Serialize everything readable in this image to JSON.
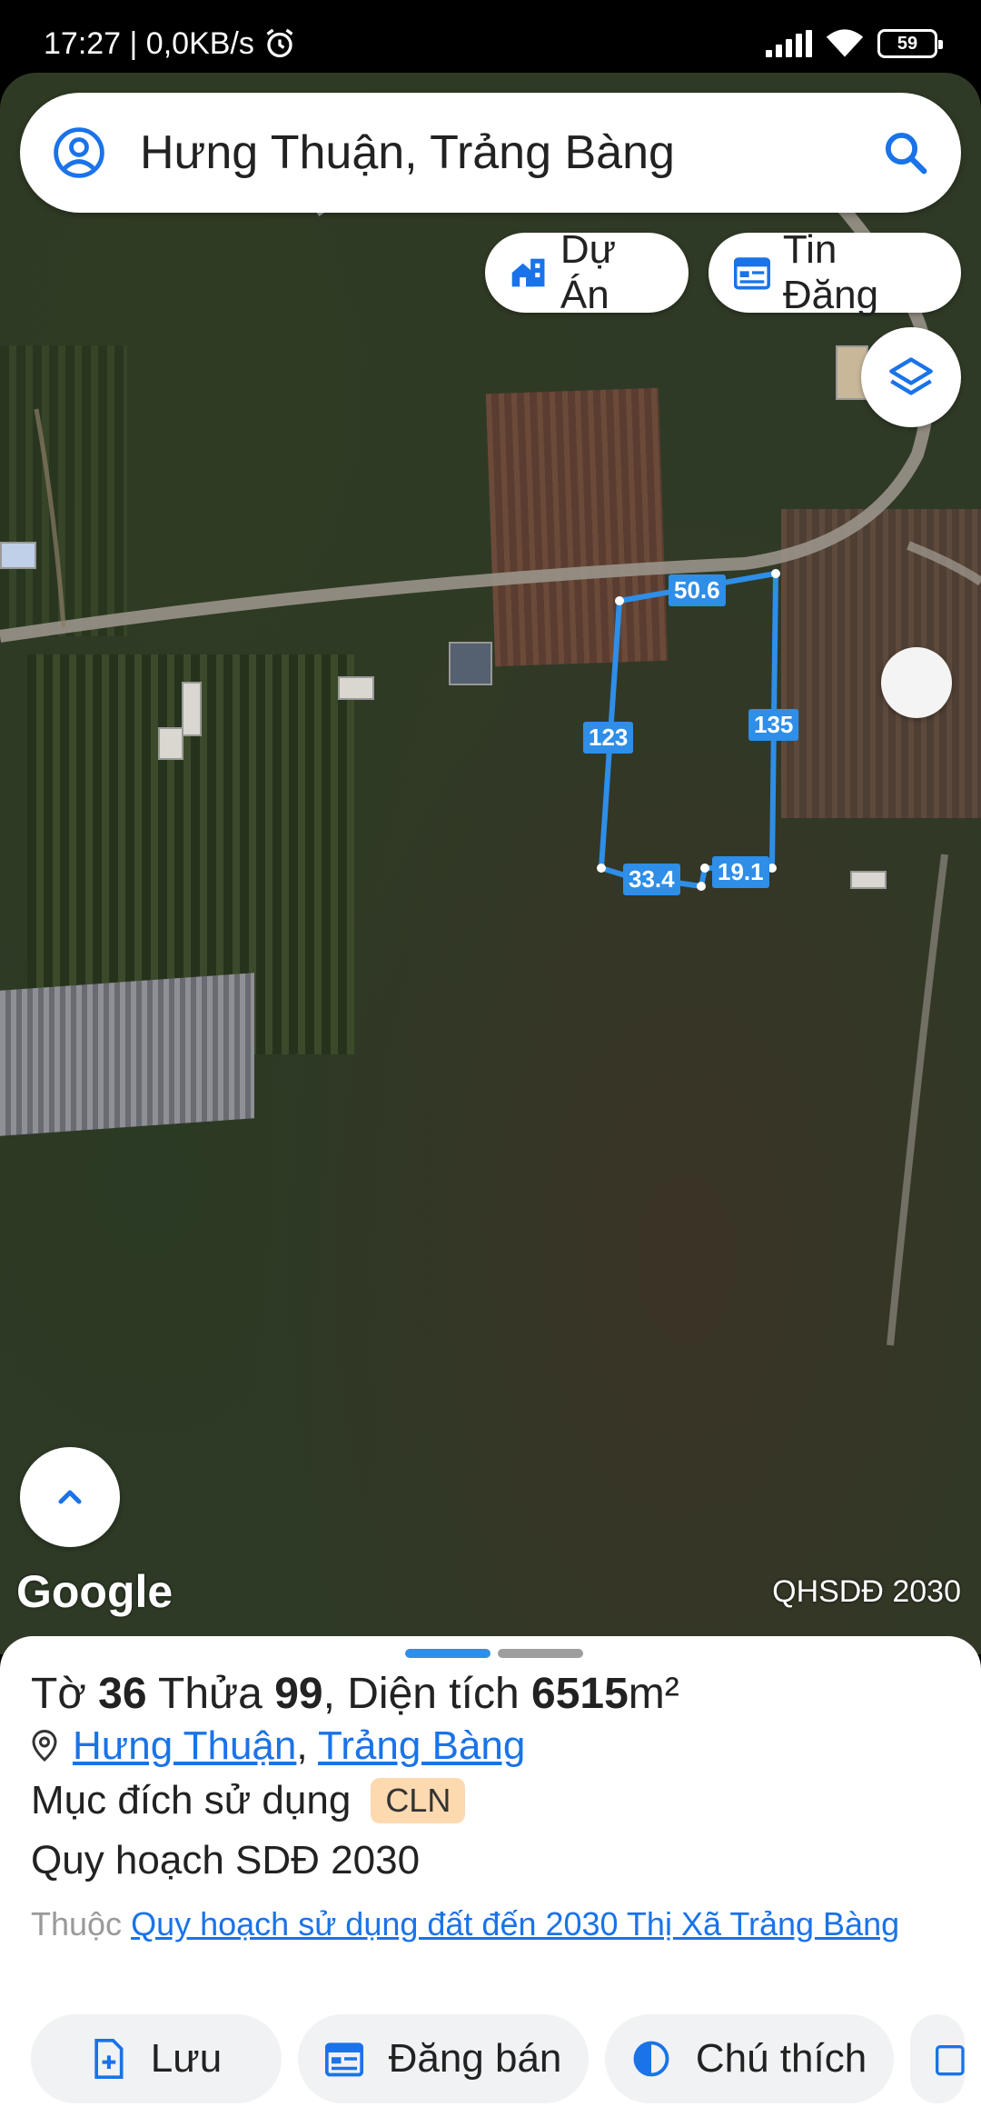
{
  "status_bar": {
    "time_speed": "17:27 | 0,0KB/s",
    "battery": "59"
  },
  "search": {
    "query": "Hưng Thuận, Trảng Bàng"
  },
  "chips": {
    "projects": "Dự Án",
    "listings": "Tin Đăng"
  },
  "map": {
    "attribution": "Google",
    "layer_tag": "QHSDĐ 2030",
    "edges": [
      "50.6",
      "123",
      "135",
      "33.4",
      "19.1"
    ],
    "plot_color": "#2e8ee8"
  },
  "sheet": {
    "sheet_label": "Tờ",
    "sheet_no": "36",
    "parcel_label": "Thửa",
    "parcel_no": "99",
    "area_label": ", Diện tích",
    "area_value": "6515",
    "area_unit": "m²",
    "commune": "Hưng Thuận",
    "district": "Trảng Bàng",
    "purpose_label": "Mục đích sử dụng",
    "purpose_code": "CLN",
    "plan_label": "Quy hoạch SDĐ 2030",
    "belongs_prefix": "Thuộc",
    "belongs_link": "Quy hoạch sử dụng đất đến 2030 Thị Xã Trảng Bàng",
    "handle_active_color": "#2e8ee8",
    "handle_inactive_color": "#9e9e9e"
  },
  "actions": {
    "save": "Lưu",
    "post_sale": "Đăng bán",
    "legend": "Chú thích"
  },
  "colors": {
    "accent": "#1a73e8"
  }
}
